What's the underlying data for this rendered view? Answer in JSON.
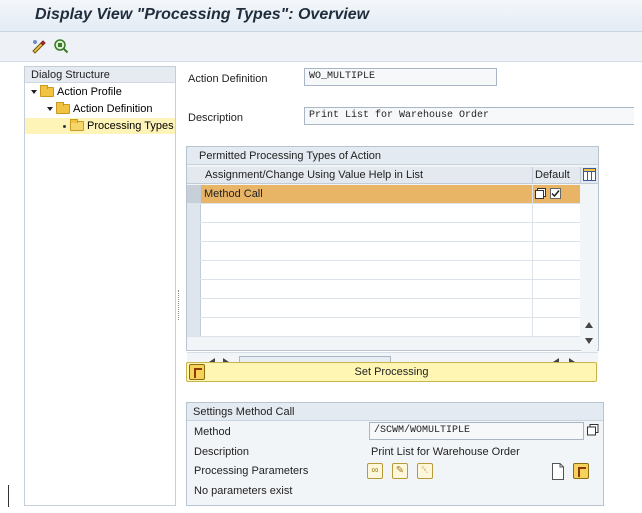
{
  "title": "Display View \"Processing Types\": Overview",
  "toolbar": {
    "icons": [
      "display-change-icon",
      "other-view-icon"
    ]
  },
  "dialog_structure": {
    "header": "Dialog Structure",
    "nodes": [
      {
        "label": "Action Profile",
        "level": 1
      },
      {
        "label": "Action Definition",
        "level": 2
      },
      {
        "label": "Processing Types",
        "level": 3,
        "selected": true
      }
    ]
  },
  "form": {
    "action_definition_label": "Action Definition",
    "action_definition_value": "WO_MULTIPLE",
    "description_label": "Description",
    "description_value": "Print List for Warehouse Order"
  },
  "permitted": {
    "title": "Permitted Processing Types of Action",
    "col_assignment": "Assignment/Change Using Value Help in List",
    "col_default": "Default",
    "rows": [
      {
        "value": "Method Call",
        "default": true,
        "selected": true
      },
      {
        "value": ""
      },
      {
        "value": ""
      },
      {
        "value": ""
      },
      {
        "value": ""
      },
      {
        "value": ""
      },
      {
        "value": ""
      },
      {
        "value": ""
      }
    ]
  },
  "set_processing": {
    "label": "Set Processing"
  },
  "settings": {
    "title": "Settings Method Call",
    "method_label": "Method",
    "method_value": "/SCWM/WOMULTIPLE",
    "description_label": "Description",
    "description_value": "Print List for Warehouse Order",
    "params_label": "Processing Parameters",
    "no_params": "No parameters exist"
  }
}
